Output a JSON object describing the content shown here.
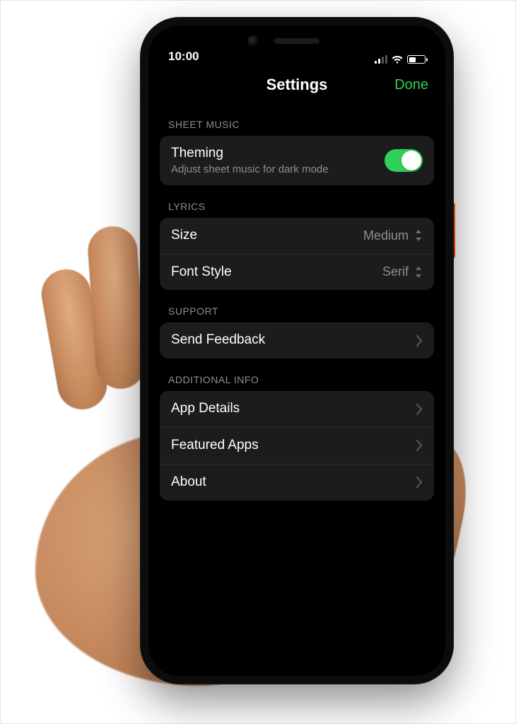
{
  "status": {
    "time": "10:00"
  },
  "nav": {
    "title": "Settings",
    "done": "Done"
  },
  "sections": {
    "sheet_music": {
      "header": "SHEET MUSIC",
      "theming": {
        "title": "Theming",
        "subtitle": "Adjust sheet music for dark mode",
        "on": true
      }
    },
    "lyrics": {
      "header": "LYRICS",
      "size": {
        "title": "Size",
        "value": "Medium"
      },
      "font": {
        "title": "Font Style",
        "value": "Serif"
      }
    },
    "support": {
      "header": "SUPPORT",
      "feedback": {
        "title": "Send Feedback"
      }
    },
    "additional": {
      "header": "ADDITIONAL INFO",
      "app_details": {
        "title": "App Details"
      },
      "featured": {
        "title": "Featured Apps"
      },
      "about": {
        "title": "About"
      }
    }
  },
  "colors": {
    "accent": "#30d158",
    "bg_group": "#1c1c1e",
    "text_secondary": "#8e8e93"
  }
}
